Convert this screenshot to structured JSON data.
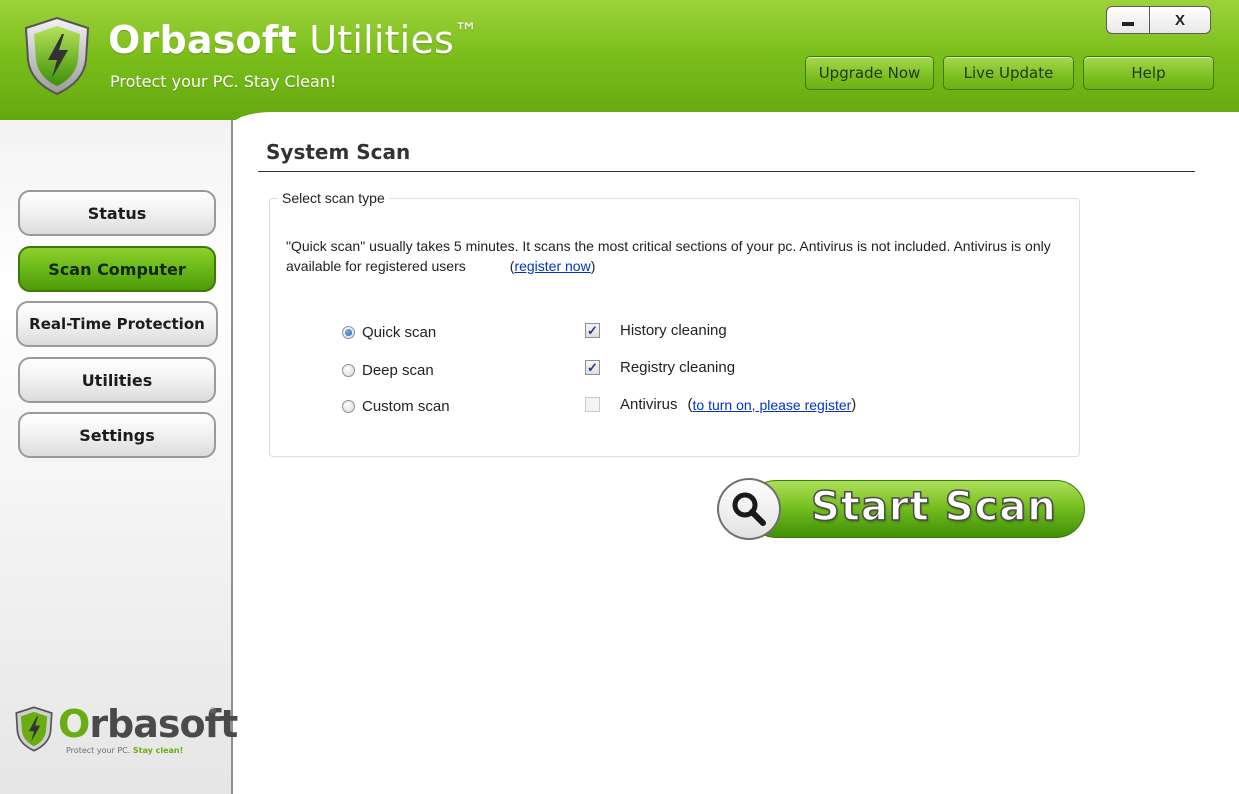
{
  "header": {
    "title_bold": "Orbasoft",
    "title_light": " Utilities",
    "title_tm": "™",
    "tagline": "Protect your PC. Stay Clean!",
    "buttons": {
      "upgrade": "Upgrade Now",
      "live_update": "Live Update",
      "help": "Help"
    },
    "window_controls": {
      "minimize": "minimize",
      "close": "X"
    }
  },
  "sidebar": {
    "items": [
      {
        "label": "Status"
      },
      {
        "label": "Scan Computer",
        "active": true
      },
      {
        "label": "Real-Time Protection"
      },
      {
        "label": "Utilities"
      },
      {
        "label": "Settings"
      }
    ],
    "logo": {
      "name_o": "O",
      "name_rest": "rbasoft",
      "registered": "®",
      "tagline_plain": "Protect your PC. ",
      "tagline_strong": "Stay clean!"
    }
  },
  "main": {
    "title": "System Scan",
    "group_legend": "Select scan type",
    "description": "\"Quick scan\" usually takes 5 minutes. It scans the most critical sections of your pc. Antivirus is not included. Antivirus is only available for registered users",
    "register_prefix": "(",
    "register_link": "register now",
    "register_suffix": ")",
    "scan_types": [
      {
        "label": "Quick scan",
        "checked": true
      },
      {
        "label": "Deep scan",
        "checked": false
      },
      {
        "label": "Custom scan",
        "checked": false
      }
    ],
    "options": [
      {
        "label": "History cleaning",
        "checked": true
      },
      {
        "label": "Registry cleaning",
        "checked": true
      },
      {
        "label": "Antivirus",
        "checked": false
      }
    ],
    "antivirus_prefix": "(",
    "antivirus_link": "to turn on, please register",
    "antivirus_suffix": ")",
    "start_scan": "Start Scan"
  },
  "colors": {
    "header_green": "#7cbf1c",
    "active_nav": "#6ab818",
    "link": "#0033cc"
  }
}
